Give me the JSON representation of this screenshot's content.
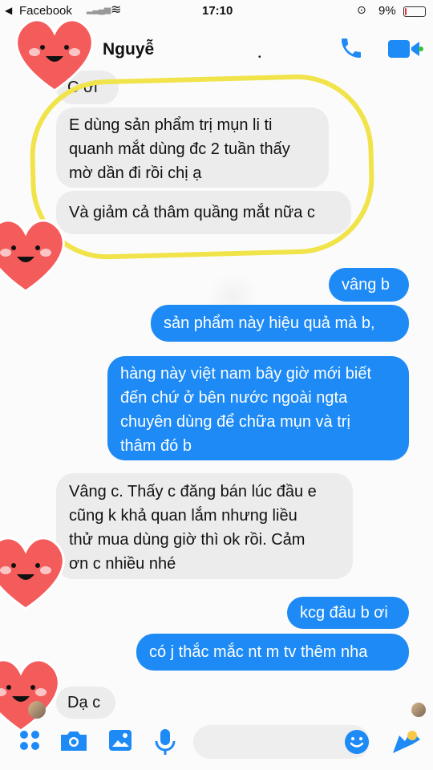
{
  "status_bar": {
    "back_app": "Facebook",
    "time": "17:10",
    "battery_percent": "9%",
    "battery_level": 0.09,
    "battery_color": "#e5322d"
  },
  "header": {
    "contact_name": "Nguyễ",
    "phone_icon": "phone-icon",
    "video_icon": "video-call-icon",
    "accent_color": "#1d8af5"
  },
  "messages": [
    {
      "side": "incoming",
      "text_lines": [
        "C ơi"
      ]
    },
    {
      "side": "incoming",
      "text_lines": [
        "E dùng sản phẩm trị mụn li ti",
        "quanh mắt dùng đc 2 tuần thấy",
        "mờ dần đi rồi chị ạ"
      ]
    },
    {
      "side": "incoming",
      "text_lines": [
        "Và giảm cả thâm quầng mắt nữa c"
      ]
    },
    {
      "side": "outgoing",
      "text_lines": [
        "vâng b"
      ]
    },
    {
      "side": "outgoing",
      "text_lines": [
        "sản phẩm này hiệu quả mà b,"
      ]
    },
    {
      "side": "outgoing",
      "text_lines": [
        "hàng này việt nam bây giờ mới biết",
        "đến chứ ở bên nước ngoài ngta",
        "chuyên dùng để chữa mụn và trị",
        "thâm đó b"
      ]
    },
    {
      "side": "incoming",
      "text_lines": [
        "Vâng c. Thấy c đăng bán lúc đầu e",
        "cũng k khả quan lắm nhưng liều",
        "thử mua dùng giờ thì ok rồi. Cảm",
        "ơn c nhiều nhé"
      ]
    },
    {
      "side": "outgoing",
      "text_lines": [
        "kcg đâu b ơi"
      ]
    },
    {
      "side": "outgoing",
      "text_lines": [
        "có j thắc mắc nt m tv thêm nha"
      ]
    },
    {
      "side": "incoming",
      "text_lines": [
        "Dạ c"
      ]
    }
  ],
  "composer": {
    "icons": [
      "apps-icon",
      "camera-icon",
      "image-icon",
      "microphone-icon",
      "emoji-icon",
      "send-icon"
    ],
    "input_value": ""
  },
  "annotation": {
    "highlight_color": "#f1e34a",
    "sticker": "heart-face-sticker"
  }
}
